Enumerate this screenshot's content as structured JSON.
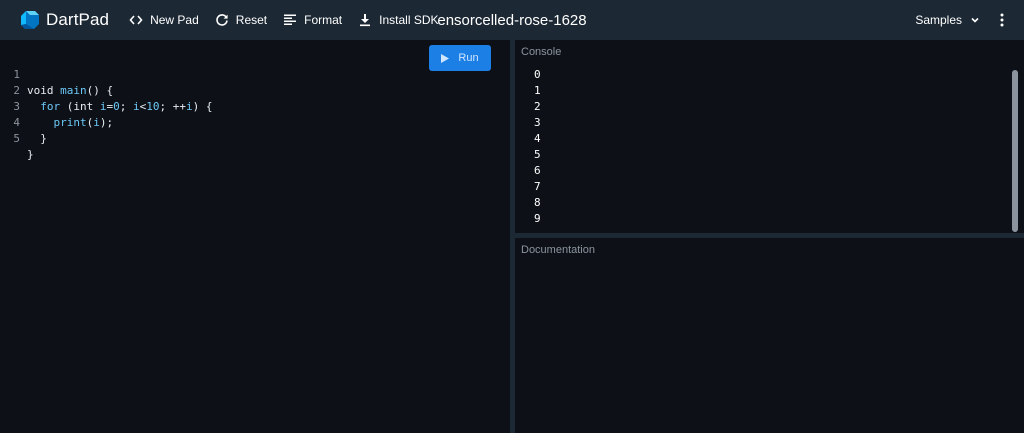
{
  "app": {
    "name": "DartPad",
    "pad_title": "ensorcelled-rose-1628"
  },
  "toolbar": {
    "new_pad": "New Pad",
    "reset": "Reset",
    "format": "Format",
    "install_sdk": "Install SDK",
    "samples": "Samples",
    "icons": {
      "new_pad": "code-brackets-icon",
      "reset": "refresh-icon",
      "format": "format-lines-icon",
      "install_sdk": "download-icon",
      "samples": "chevron-down-icon",
      "more": "more-vertical-icon"
    }
  },
  "editor": {
    "run_label": "Run",
    "lines": [
      {
        "n": "1"
      },
      {
        "n": "2"
      },
      {
        "n": "3"
      },
      {
        "n": "4"
      },
      {
        "n": "5"
      }
    ],
    "tokens": {
      "l1_a": "void ",
      "l1_b": "main",
      "l1_c": "() {",
      "l2_a": "  ",
      "l2_b": "for",
      "l2_c": " (int ",
      "l2_d": "i",
      "l2_e": "=",
      "l2_f": "0",
      "l2_g": "; ",
      "l2_h": "i",
      "l2_i": "<",
      "l2_j": "10",
      "l2_k": "; ++",
      "l2_l": "i",
      "l2_m": ") {",
      "l3_a": "    ",
      "l3_b": "print",
      "l3_c": "(",
      "l3_d": "i",
      "l3_e": ");",
      "l4_a": "  }",
      "l5_a": "}"
    }
  },
  "console": {
    "label": "Console",
    "output": [
      "0",
      "1",
      "2",
      "3",
      "4",
      "5",
      "6",
      "7",
      "8",
      "9"
    ]
  },
  "documentation": {
    "label": "Documentation"
  },
  "colors": {
    "topbar": "#1c2834",
    "background": "#0d1117",
    "accent": "#1c7fe6",
    "keyword": "#6cc7f6",
    "muted": "#8b949e"
  }
}
